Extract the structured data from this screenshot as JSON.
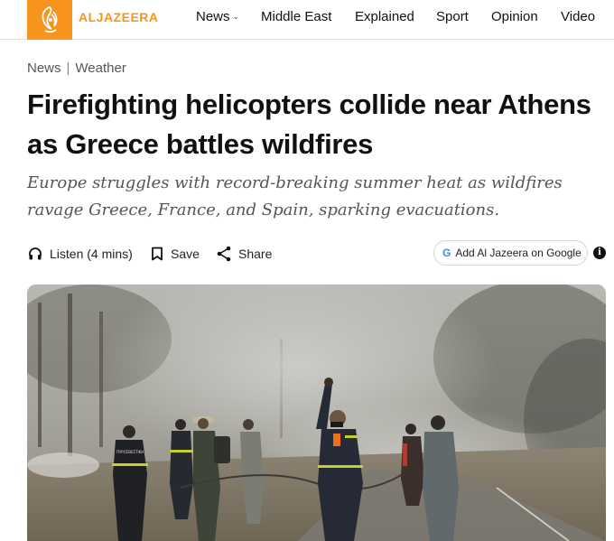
{
  "header": {
    "logo_text": "ALJAZEERA",
    "nav": [
      {
        "label": "News",
        "has_dropdown": true
      },
      {
        "label": "Middle East"
      },
      {
        "label": "Explained"
      },
      {
        "label": "Sport"
      },
      {
        "label": "Opinion"
      },
      {
        "label": "Video"
      }
    ]
  },
  "breadcrumb": {
    "items": [
      "News",
      "Weather"
    ],
    "separator": "|"
  },
  "article": {
    "title": "Firefighting helicopters collide near Athens as Greece battles wildfires",
    "subtitle": "Europe struggles with record-breaking summer heat as wildfires ravage Greece, France, and Spain, sparking evacuations."
  },
  "actions": {
    "listen": "Listen (4 mins)",
    "save": "Save",
    "share": "Share",
    "google": "Add Al Jazeera on Google",
    "google_letter": "G",
    "info": "i"
  },
  "photo": {
    "vest_text": "ΠΥΡΟΣΒΕΣΤΙΚΗ"
  },
  "colors": {
    "brand": "#f7941d",
    "text": "#111111",
    "muted": "#555555"
  },
  "icons": [
    "aljazeera-logo-icon",
    "chevron-down-icon",
    "headphones-icon",
    "bookmark-icon",
    "share-icon",
    "google-icon",
    "info-icon"
  ]
}
